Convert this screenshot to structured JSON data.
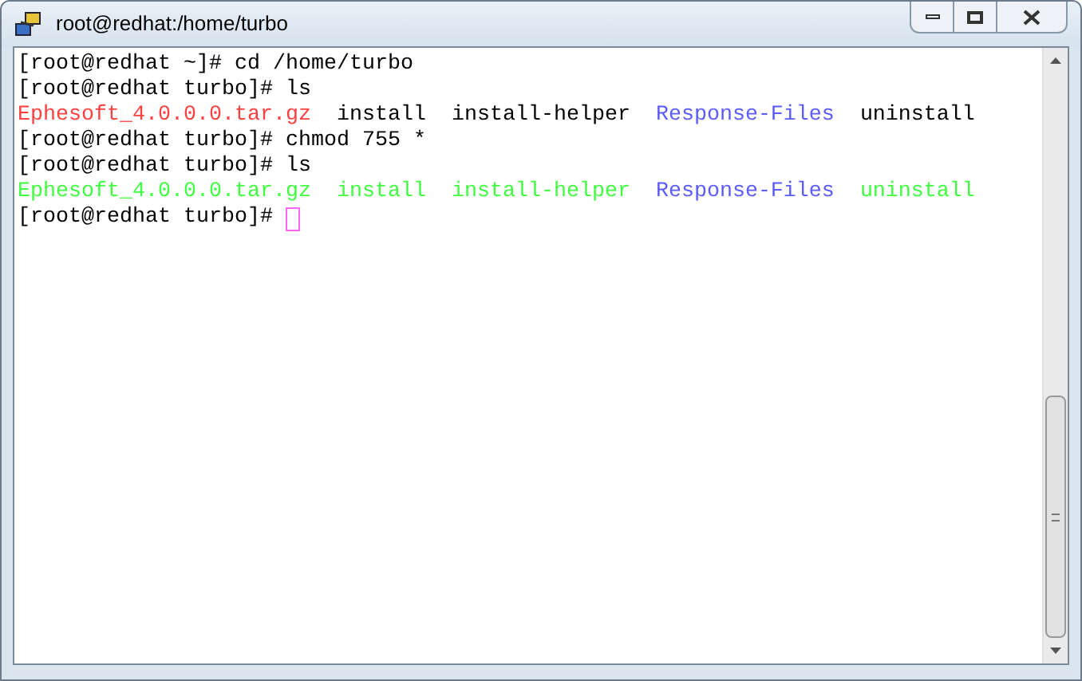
{
  "window": {
    "title": "root@redhat:/home/turbo"
  },
  "terminal": {
    "lines": [
      {
        "kind": "prompt",
        "text": "[root@redhat ~]# cd /home/turbo"
      },
      {
        "kind": "prompt",
        "text": "[root@redhat turbo]# ls"
      },
      {
        "kind": "listing",
        "files": [
          {
            "name": "Ephesoft_4.0.0.0.tar.gz",
            "color": "#ff4040"
          },
          {
            "name": "install",
            "color": "#000000"
          },
          {
            "name": "install-helper",
            "color": "#000000"
          },
          {
            "name": "Response-Files",
            "color": "#5b5bff"
          },
          {
            "name": "uninstall",
            "color": "#000000"
          }
        ]
      },
      {
        "kind": "prompt",
        "text": "[root@redhat turbo]# chmod 755 *"
      },
      {
        "kind": "prompt",
        "text": "[root@redhat turbo]# ls"
      },
      {
        "kind": "listing",
        "files": [
          {
            "name": "Ephesoft_4.0.0.0.tar.gz",
            "color": "#40ff40"
          },
          {
            "name": "install",
            "color": "#40ff40"
          },
          {
            "name": "install-helper",
            "color": "#40ff40"
          },
          {
            "name": "Response-Files",
            "color": "#5b5bff"
          },
          {
            "name": "uninstall",
            "color": "#40ff40"
          }
        ]
      },
      {
        "kind": "prompt",
        "text": "[root@redhat turbo]#",
        "cursor": true
      }
    ]
  }
}
